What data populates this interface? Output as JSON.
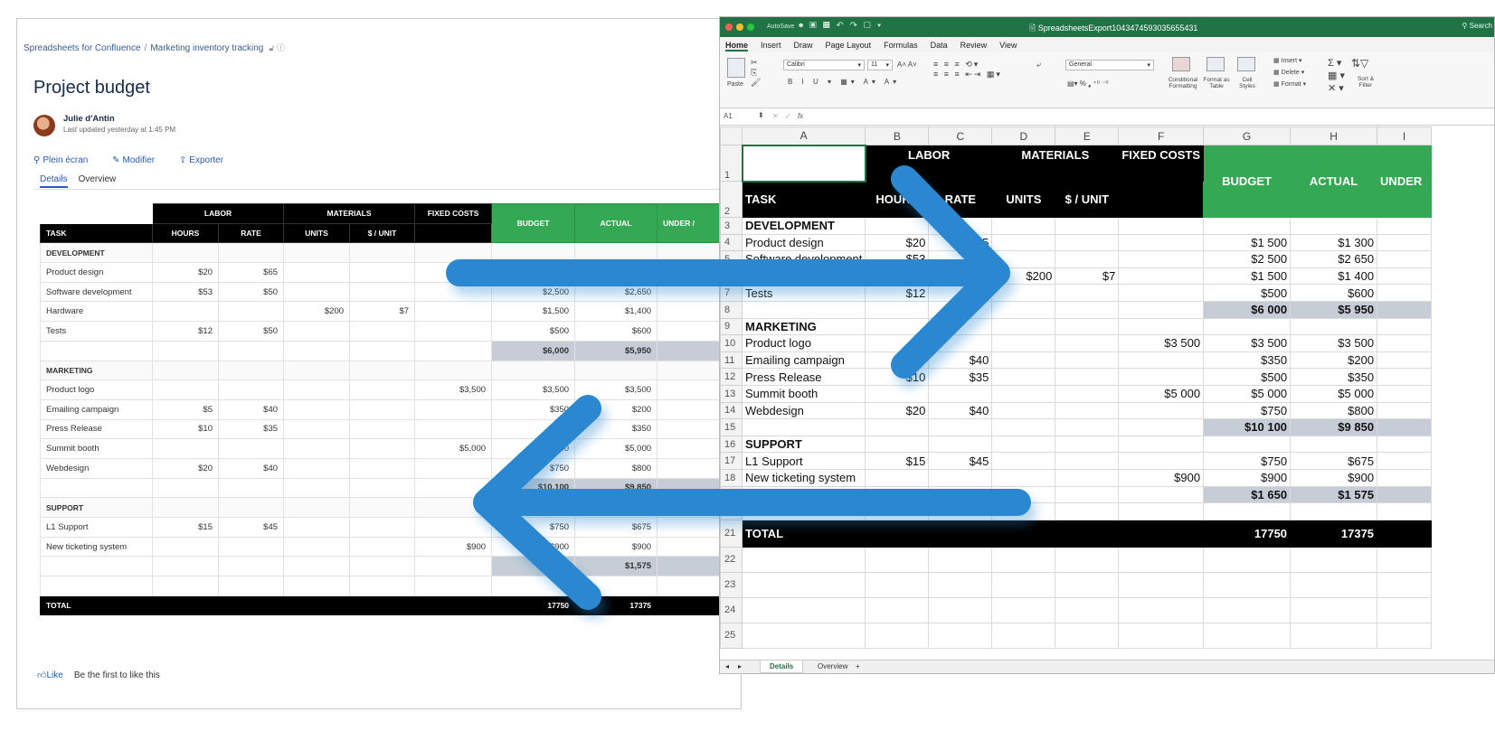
{
  "confluence": {
    "breadcrumb": [
      "Spreadsheets for Confluence",
      "Marketing inventory tracking"
    ],
    "breadcrumb_sep": "/",
    "page_title": "Project budget",
    "author": "Julie d'Antin",
    "updated": "Last updated yesterday at 1:45 PM",
    "actions": [
      "Plein écran",
      "Modifier",
      "Exporter"
    ],
    "tabs": [
      "Details",
      "Overview"
    ],
    "like_label": "Like",
    "like_text": "Be the first to like this",
    "table": {
      "group_headers": {
        "labor": "LABOR",
        "materials": "MATERIALS",
        "fixed": "FIXED COSTS",
        "budget": "BUDGET",
        "actual": "ACTUAL",
        "under": "UNDER /"
      },
      "sub_headers": {
        "task": "TASK",
        "hours": "HOURS",
        "rate": "RATE",
        "units": "UNITS",
        "per_unit": "$ / UNIT"
      },
      "rows": [
        {
          "kind": "section",
          "task": "DEVELOPMENT"
        },
        {
          "kind": "item",
          "task": "Product design",
          "hours": "$20",
          "rate": "$65",
          "units": "",
          "per_unit": "",
          "fixed": "",
          "budget": "$1,500",
          "actual": "$1,300"
        },
        {
          "kind": "item",
          "task": "Software development",
          "hours": "$53",
          "rate": "$50",
          "units": "",
          "per_unit": "",
          "fixed": "",
          "budget": "$2,500",
          "actual": "$2,650"
        },
        {
          "kind": "item",
          "task": "Hardware",
          "hours": "",
          "rate": "",
          "units": "$200",
          "per_unit": "$7",
          "fixed": "",
          "budget": "$1,500",
          "actual": "$1,400"
        },
        {
          "kind": "item",
          "task": "Tests",
          "hours": "$12",
          "rate": "$50",
          "units": "",
          "per_unit": "",
          "fixed": "",
          "budget": "$500",
          "actual": "$600"
        },
        {
          "kind": "subtotal",
          "budget": "$6,000",
          "actual": "$5,950"
        },
        {
          "kind": "section",
          "task": "MARKETING"
        },
        {
          "kind": "item",
          "task": "Product logo",
          "hours": "",
          "rate": "",
          "units": "",
          "per_unit": "",
          "fixed": "$3,500",
          "budget": "$3,500",
          "actual": "$3,500"
        },
        {
          "kind": "item",
          "task": "Emailing campaign",
          "hours": "$5",
          "rate": "$40",
          "units": "",
          "per_unit": "",
          "fixed": "",
          "budget": "$350",
          "actual": "$200"
        },
        {
          "kind": "item",
          "task": "Press Release",
          "hours": "$10",
          "rate": "$35",
          "units": "",
          "per_unit": "",
          "fixed": "",
          "budget": "$500",
          "actual": "$350"
        },
        {
          "kind": "item",
          "task": "Summit booth",
          "hours": "",
          "rate": "",
          "units": "",
          "per_unit": "",
          "fixed": "$5,000",
          "budget": "$5,000",
          "actual": "$5,000"
        },
        {
          "kind": "item",
          "task": "Webdesign",
          "hours": "$20",
          "rate": "$40",
          "units": "",
          "per_unit": "",
          "fixed": "",
          "budget": "$750",
          "actual": "$800"
        },
        {
          "kind": "subtotal",
          "budget": "$10,100",
          "actual": "$9,850"
        },
        {
          "kind": "section",
          "task": "SUPPORT"
        },
        {
          "kind": "item",
          "task": "L1 Support",
          "hours": "$15",
          "rate": "$45",
          "units": "",
          "per_unit": "",
          "fixed": "",
          "budget": "$750",
          "actual": "$675"
        },
        {
          "kind": "item",
          "task": "New ticketing system",
          "hours": "",
          "rate": "",
          "units": "",
          "per_unit": "",
          "fixed": "$900",
          "budget": "$900",
          "actual": "$900"
        },
        {
          "kind": "subtotal",
          "budget": "$1,650",
          "actual": "$1,575"
        },
        {
          "kind": "blank"
        },
        {
          "kind": "total",
          "task": "TOTAL",
          "budget": "17750",
          "actual": "17375"
        }
      ]
    }
  },
  "excel": {
    "window_title": "SpreadsheetsExport1043474593035655431",
    "search": "Search",
    "autosave": "AutoSave",
    "menu": [
      "Home",
      "Insert",
      "Draw",
      "Page Layout",
      "Formulas",
      "Data",
      "Review",
      "View"
    ],
    "ribbon": {
      "paste": "Paste",
      "font_name": "Calibri",
      "font_size": "11",
      "number_format": "General",
      "conditional": "Conditional Formatting",
      "format_table": "Format as Table",
      "cell_styles": "Cell Styles",
      "insert": "Insert",
      "delete": "Delete",
      "format": "Format",
      "sort": "Sort & Filter"
    },
    "name_box": "A1",
    "fx": "fx",
    "columns": [
      "A",
      "B",
      "C",
      "D",
      "E",
      "F",
      "G",
      "H",
      "I"
    ],
    "headers": {
      "labor": "LABOR",
      "materials": "MATERIALS",
      "fixed": "FIXED COSTS",
      "task": "TASK",
      "hours": "HOURS",
      "rate": "RATE",
      "units": "UNITS",
      "per_unit": "$ / UNIT",
      "budget": "BUDGET",
      "actual": "ACTUAL",
      "under": "UNDER"
    },
    "rows": [
      {
        "n": "3",
        "kind": "section",
        "a": "DEVELOPMENT"
      },
      {
        "n": "4",
        "kind": "item",
        "a": "Product design",
        "b": "$20",
        "c": "$65",
        "d": "",
        "e": "",
        "f": "",
        "g": "$1 500",
        "h": "$1 300"
      },
      {
        "n": "5",
        "kind": "item",
        "a": "Software development",
        "b": "$53",
        "c": "$50",
        "d": "",
        "e": "",
        "f": "",
        "g": "$2 500",
        "h": "$2 650"
      },
      {
        "n": "6",
        "kind": "item",
        "a": "Hardware",
        "b": "",
        "c": "",
        "d": "$200",
        "e": "$7",
        "f": "",
        "g": "$1 500",
        "h": "$1 400"
      },
      {
        "n": "7",
        "kind": "item",
        "a": "Tests",
        "b": "$12",
        "c": "$50",
        "d": "",
        "e": "",
        "f": "",
        "g": "$500",
        "h": "$600"
      },
      {
        "n": "8",
        "kind": "subtotal",
        "g": "$6 000",
        "h": "$5 950"
      },
      {
        "n": "9",
        "kind": "section",
        "a": "MARKETING"
      },
      {
        "n": "10",
        "kind": "item",
        "a": "Product logo",
        "b": "",
        "c": "",
        "d": "",
        "e": "",
        "f": "$3 500",
        "g": "$3 500",
        "h": "$3 500"
      },
      {
        "n": "11",
        "kind": "item",
        "a": "Emailing campaign",
        "b": "$5",
        "c": "$40",
        "d": "",
        "e": "",
        "f": "",
        "g": "$350",
        "h": "$200"
      },
      {
        "n": "12",
        "kind": "item",
        "a": "Press Release",
        "b": "$10",
        "c": "$35",
        "d": "",
        "e": "",
        "f": "",
        "g": "$500",
        "h": "$350"
      },
      {
        "n": "13",
        "kind": "item",
        "a": "Summit booth",
        "b": "",
        "c": "",
        "d": "",
        "e": "",
        "f": "$5 000",
        "g": "$5 000",
        "h": "$5 000"
      },
      {
        "n": "14",
        "kind": "item",
        "a": "Webdesign",
        "b": "$20",
        "c": "$40",
        "d": "",
        "e": "",
        "f": "",
        "g": "$750",
        "h": "$800"
      },
      {
        "n": "15",
        "kind": "subtotal",
        "g": "$10 100",
        "h": "$9 850"
      },
      {
        "n": "16",
        "kind": "section",
        "a": "SUPPORT"
      },
      {
        "n": "17",
        "kind": "item",
        "a": "L1 Support",
        "b": "$15",
        "c": "$45",
        "d": "",
        "e": "",
        "f": "",
        "g": "$750",
        "h": "$675"
      },
      {
        "n": "18",
        "kind": "item",
        "a": "New ticketing system",
        "b": "",
        "c": "",
        "d": "",
        "e": "",
        "f": "$900",
        "g": "$900",
        "h": "$900"
      },
      {
        "n": "19",
        "kind": "subtotal",
        "g": "$1 650",
        "h": "$1 575"
      },
      {
        "n": "20",
        "kind": "blank"
      },
      {
        "n": "21",
        "kind": "total",
        "a": "TOTAL",
        "g": "17750",
        "h": "17375"
      },
      {
        "n": "22",
        "kind": "blank"
      },
      {
        "n": "23",
        "kind": "blank"
      },
      {
        "n": "24",
        "kind": "blank"
      },
      {
        "n": "25",
        "kind": "blank"
      }
    ],
    "sheet_tabs": [
      "Details",
      "Overview"
    ],
    "add_sheet": "+"
  },
  "colors": {
    "excel_green": "#217346",
    "budget_green": "#34a853",
    "subtotal_gray": "#c6cdd6",
    "arrow_blue": "#2b88d0"
  }
}
